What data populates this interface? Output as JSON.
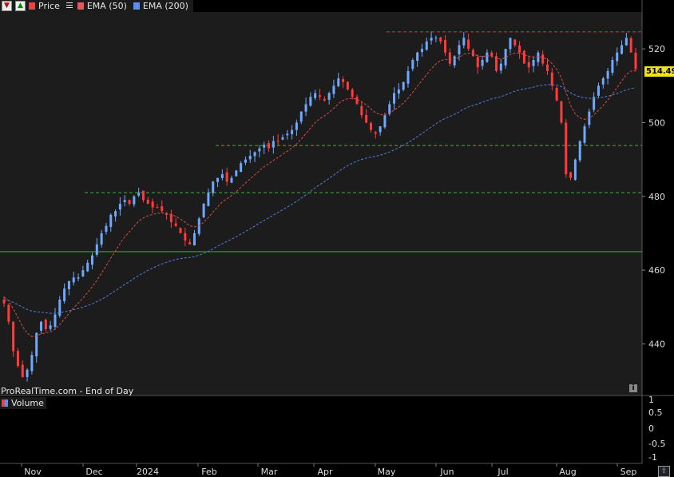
{
  "legend": {
    "items": [
      {
        "label": "Price",
        "color": "#e04848"
      },
      {
        "label": "EMA (50)",
        "color": "#e05a5a"
      },
      {
        "label": "EMA (200)",
        "color": "#5a8ef0"
      }
    ]
  },
  "source_label": "ProRealTime.com - End of Day",
  "volume_label": "Volume",
  "last_price": "514.49",
  "colors": {
    "up": "#6fa8ff",
    "down": "#ff3b3b",
    "ema50": "#d64b4b",
    "ema200": "#4f7de0",
    "support": "#3fb33f",
    "resistance": "#e03535",
    "badge": "#f1e21c"
  },
  "chart_data": {
    "type": "candlestick",
    "y_axis": {
      "ticks": [
        440,
        460,
        480,
        500,
        520
      ],
      "range": [
        426,
        530
      ]
    },
    "volume_axis": {
      "ticks": [
        "1",
        "0.5",
        "0",
        "-0.5",
        "-1"
      ]
    },
    "x_axis": {
      "labels": [
        "Nov",
        "Dec",
        "2024",
        "Feb",
        "Mar",
        "Apr",
        "May",
        "Jun",
        "Jul",
        "Aug",
        "Sep"
      ]
    },
    "horizontal_lines": [
      {
        "value": 524.6,
        "style": "dashed",
        "color": "red"
      },
      {
        "value": 493.8,
        "style": "dashed",
        "color": "green"
      },
      {
        "value": 481.0,
        "style": "dashed",
        "color": "green"
      },
      {
        "value": 465.0,
        "style": "solid",
        "color": "green"
      }
    ],
    "close_series": [
      451,
      446,
      438,
      434,
      431,
      433,
      437,
      443,
      446,
      444,
      445,
      448,
      452,
      455,
      457,
      458,
      458,
      460,
      462,
      464,
      467,
      470,
      472,
      475,
      476,
      478,
      479,
      478,
      480,
      481,
      479,
      478,
      477,
      477,
      476,
      475,
      473,
      472,
      470,
      468,
      467,
      470,
      474,
      478,
      481,
      484,
      485,
      486,
      484,
      485,
      487,
      489,
      490,
      491,
      492,
      493,
      494,
      493,
      495,
      495,
      496,
      497,
      498,
      500,
      503,
      505,
      507,
      508,
      507,
      506,
      508,
      510,
      512,
      511,
      509,
      507,
      505,
      502,
      500,
      498,
      497,
      499,
      502,
      505,
      508,
      509,
      511,
      514,
      517,
      519,
      520,
      522,
      523,
      523,
      522,
      519,
      516,
      518,
      521,
      523,
      520,
      518,
      515,
      517,
      519,
      518,
      514,
      516,
      520,
      523,
      521,
      519,
      516,
      515,
      517,
      519,
      516,
      514,
      510,
      506,
      500,
      486,
      485,
      490,
      495,
      499,
      503,
      507,
      510,
      512,
      514,
      517,
      519,
      521,
      523,
      519,
      514.49
    ],
    "ema50_end": 512.5,
    "ema200_end": 499.5
  }
}
